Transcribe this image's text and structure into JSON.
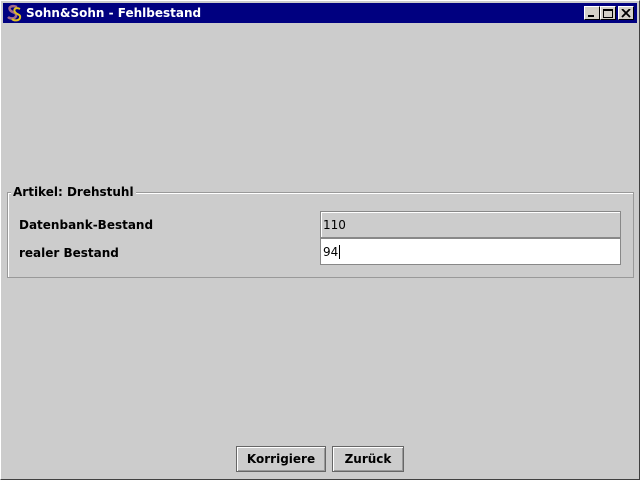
{
  "window": {
    "title": "Sohn&Sohn - Fehlbestand",
    "icon": "sohn-sohn-logo-icon",
    "controls": [
      "minimize-icon",
      "maximize-icon",
      "close-icon"
    ]
  },
  "panel": {
    "legend": "Artikel: Drehstuhl",
    "rows": [
      {
        "label": "Datenbank-Bestand",
        "value": "110"
      },
      {
        "label": "realer Bestand",
        "value": "94"
      }
    ]
  },
  "buttons": {
    "correct": "Korrigiere",
    "back": "Zurück"
  },
  "colors": {
    "titlebar": "#000080",
    "background": "#cccccc"
  }
}
